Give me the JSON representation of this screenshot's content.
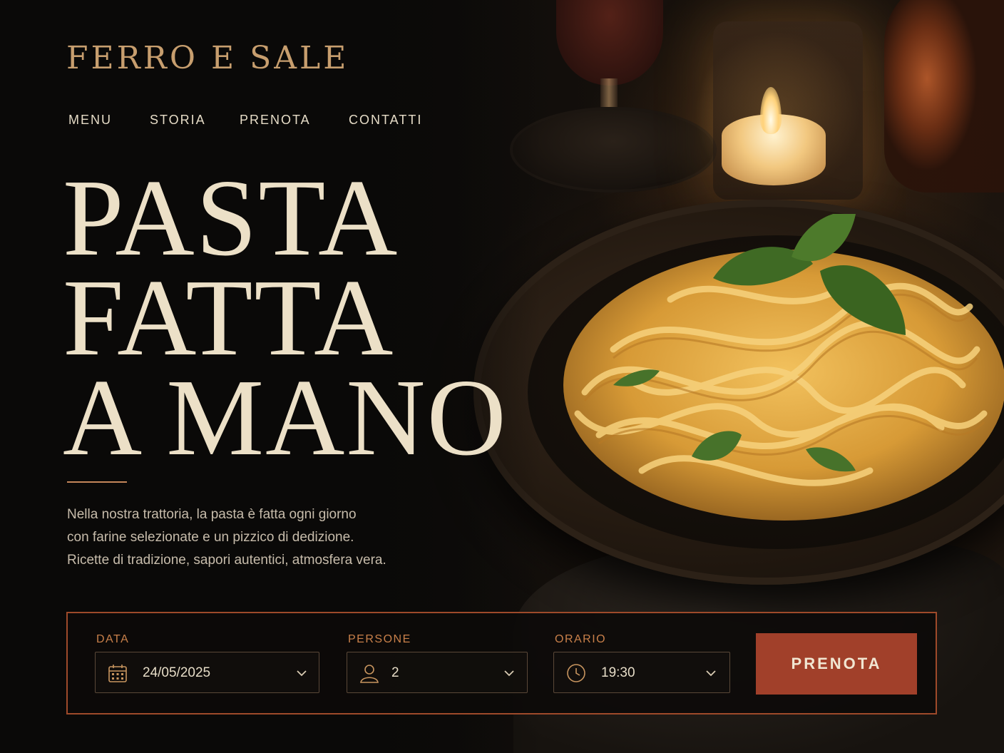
{
  "brand": {
    "name": "FERRO E SALE"
  },
  "nav": {
    "items": [
      "MENU",
      "STORIA",
      "PRENOTA",
      "CONTATTI"
    ]
  },
  "hero": {
    "title_lines": [
      "PASTA",
      "FATTA",
      "A MANO"
    ],
    "intro_lines": [
      "Nella nostra trattoria, la pasta è fatta ogni giorno",
      "con farine selezionate e un pizzico di dedizione.",
      "Ricette di tradizione, sapori autentici, atmosfera vera."
    ]
  },
  "booking": {
    "date": {
      "label": "DATA",
      "value": "24/05/2025",
      "icon": "calendar-icon"
    },
    "guests": {
      "label": "PERSONE",
      "value": "2",
      "icon": "person-icon"
    },
    "time": {
      "label": "ORARIO",
      "value": "19:30",
      "icon": "clock-icon"
    },
    "submit_label": "PRENOTA"
  },
  "colors": {
    "accent": "#a1402a",
    "gold": "#c79e6e",
    "text": "#ece0c7",
    "background": "#0c0a09"
  }
}
